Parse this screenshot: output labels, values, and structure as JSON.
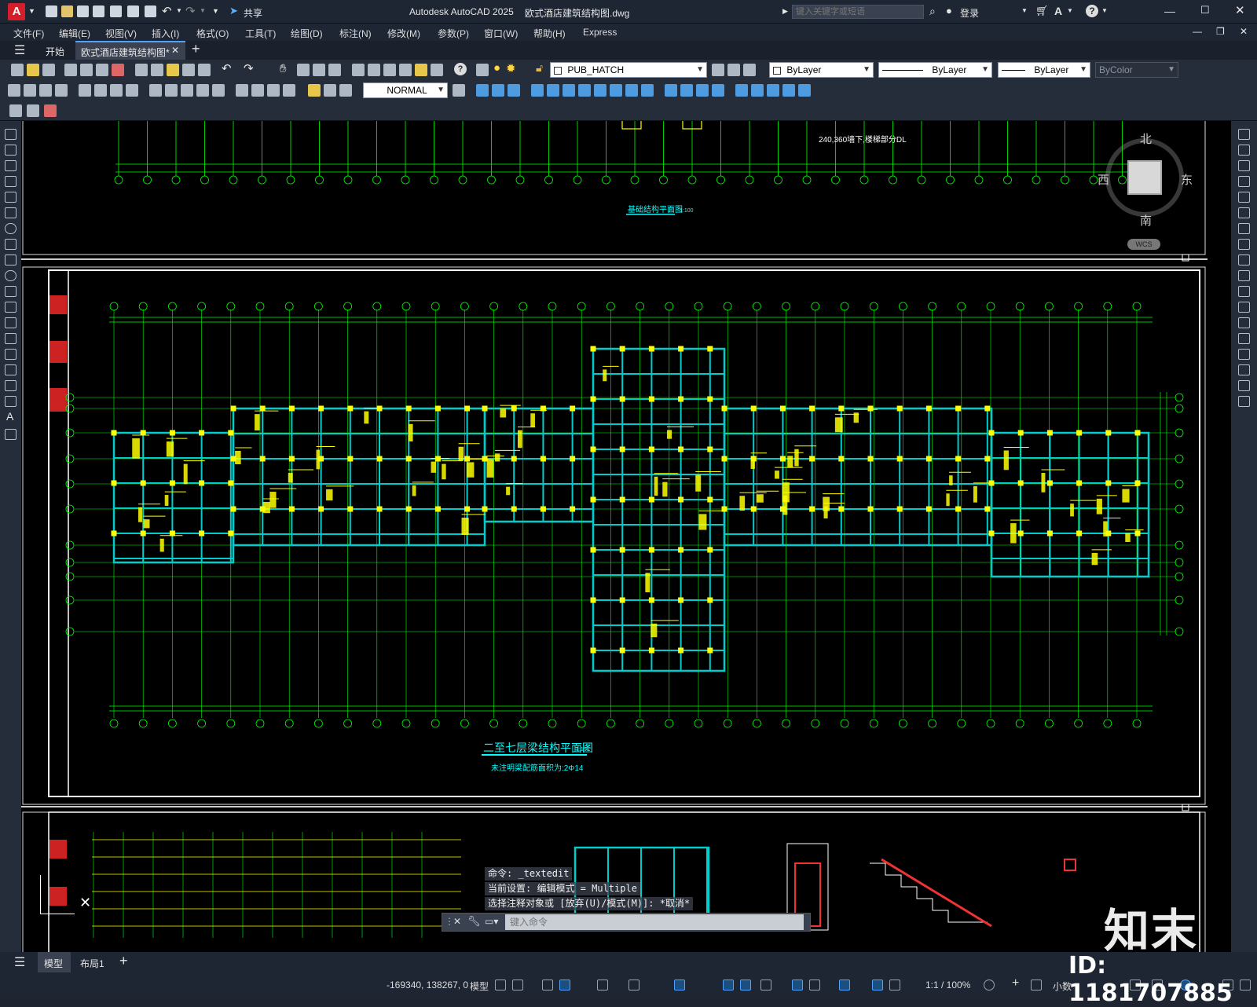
{
  "app": {
    "logo_letter": "A",
    "title": "Autodesk AutoCAD 2025",
    "document": "欧式酒店建筑结构图.dwg",
    "share_label": "共享",
    "search_placeholder": "键入关键字或短语",
    "login_label": "登录"
  },
  "menu": [
    "文件(F)",
    "编辑(E)",
    "视图(V)",
    "插入(I)",
    "格式(O)",
    "工具(T)",
    "绘图(D)",
    "标注(N)",
    "修改(M)",
    "参数(P)",
    "窗口(W)",
    "帮助(H)",
    "Express"
  ],
  "tabs": {
    "start": "开始",
    "active": "欧式酒店建筑结构图*"
  },
  "toolbar": {
    "layer": "PUB_HATCH",
    "color": "ByLayer",
    "linetype": "ByLayer",
    "lineweight": "ByLayer",
    "plotstyle": "ByColor",
    "dimstyle": "NORMAL"
  },
  "viewcube": {
    "north": "北",
    "south": "南",
    "east": "东",
    "west": "西",
    "wcs": "WCS"
  },
  "drawing": {
    "title_top": "基础结构平面图",
    "title_top_scale": "1:100",
    "note_top": "240,360墙下,楼梯部分DL",
    "title_main": "二至七层梁结构平面图",
    "title_main_scale": "1:100",
    "subtitle_main": "未注明梁配筋面积为:2Φ14",
    "grid_left_labels": [
      "L",
      "K",
      "J",
      "H",
      "G",
      "F",
      "E",
      "D",
      "C",
      "B",
      "A"
    ]
  },
  "command": {
    "history": [
      "命令: _textedit",
      "当前设置: 编辑模式 = Multiple",
      "选择注释对象或 [放弃(U)/模式(M)]: *取消*"
    ],
    "placeholder": "键入命令"
  },
  "layouts": {
    "model": "模型",
    "layout1": "布局1"
  },
  "status": {
    "coords": "-169340, 138267, 0",
    "model": "模型",
    "scale": "1:1 / 100%",
    "units": "小数"
  },
  "watermark": {
    "brand": "知末",
    "id": "ID: 1181707885"
  },
  "colors": {
    "bg": "#000000",
    "grid": "#00ff00",
    "beam": "#00cccc",
    "column": "#ffff00",
    "text": "#00ffff"
  }
}
